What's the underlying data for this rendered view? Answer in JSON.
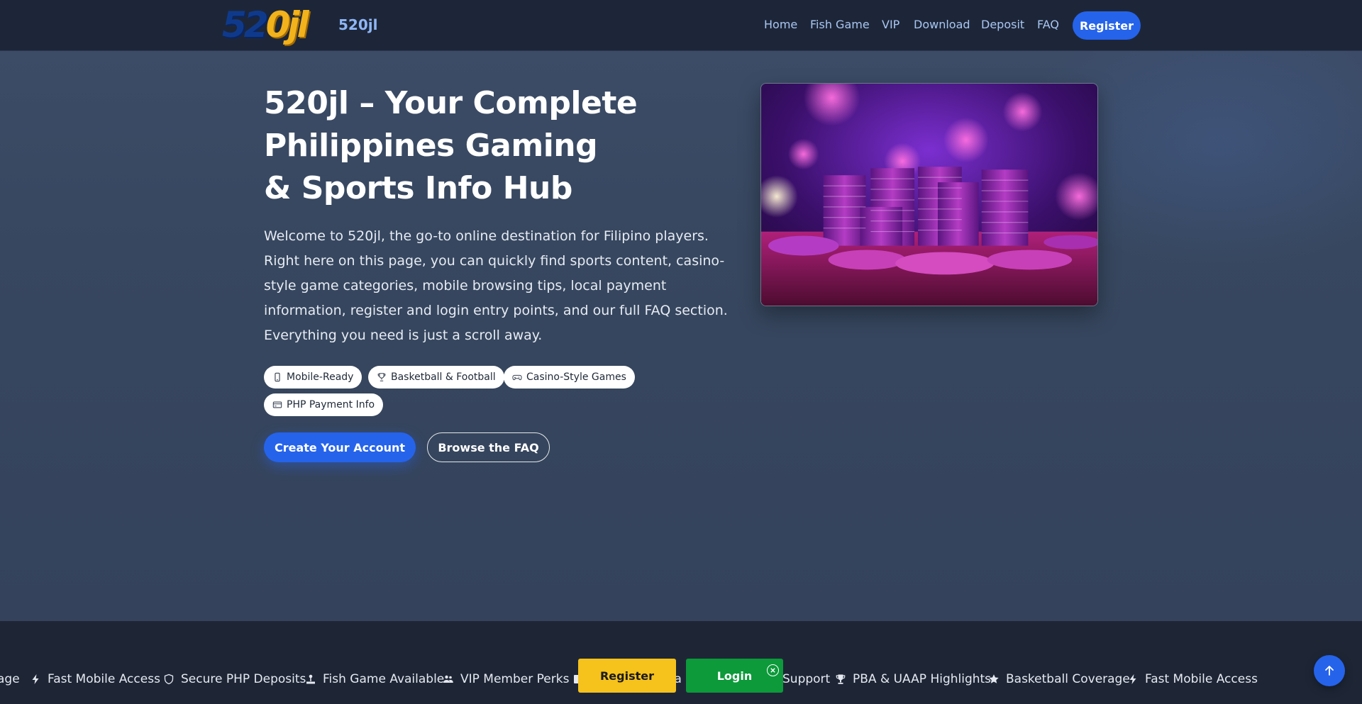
{
  "header": {
    "logo_text": "520jl",
    "logo_mark_blue": "52",
    "logo_mark_gold": "0jl",
    "nav": [
      "Home",
      "Fish Game",
      "VIP",
      "Download",
      "Deposit",
      "FAQ"
    ],
    "register_label": "Register"
  },
  "hero": {
    "title_line1": "520jl – Your Complete",
    "title_line2": "Philippines Gaming",
    "title_line3": "& Sports Info Hub",
    "description": "Welcome to 520jl, the go-to online destination for Filipino players. Right here on this page, you can quickly find sports content, casino-style game categories, mobile browsing tips, local payment information, register and login entry points, and our full FAQ section. Everything you need is just a scroll away.",
    "tags": [
      {
        "label": "Mobile-Ready",
        "icon": "phone-icon"
      },
      {
        "label": "Basketball & Football",
        "icon": "trophy-icon"
      },
      {
        "label": "Casino-Style Games",
        "icon": "gamepad-icon"
      },
      {
        "label": "PHP Payment Info",
        "icon": "card-icon"
      }
    ],
    "primary_button": "Create Your Account",
    "secondary_button": "Browse the FAQ"
  },
  "ticker": {
    "items": [
      {
        "label": "age",
        "icon": ""
      },
      {
        "label": "Fast Mobile Access",
        "icon": "bolt-icon"
      },
      {
        "label": "Secure PHP Deposits",
        "icon": "shield-icon"
      },
      {
        "label": "Fish Game Available",
        "icon": "joystick-icon"
      },
      {
        "label": "VIP Member Perks",
        "icon": "users-icon"
      },
      {
        "label": "ea",
        "icon": ""
      },
      {
        "label": "Support",
        "icon": ""
      },
      {
        "label": "PBA & UAAP Highlights",
        "icon": "trophy-icon"
      },
      {
        "label": "Basketball Coverage",
        "icon": "star-icon"
      },
      {
        "label": "Fast Mobile Access",
        "icon": "bolt-icon"
      }
    ]
  },
  "floating": {
    "register_label": "Register",
    "login_label": "Login"
  },
  "colors": {
    "accent": "#2563eb",
    "register_yellow": "#f6c21c",
    "login_green": "#0c9a3a",
    "header_bg": "#1d2638"
  }
}
